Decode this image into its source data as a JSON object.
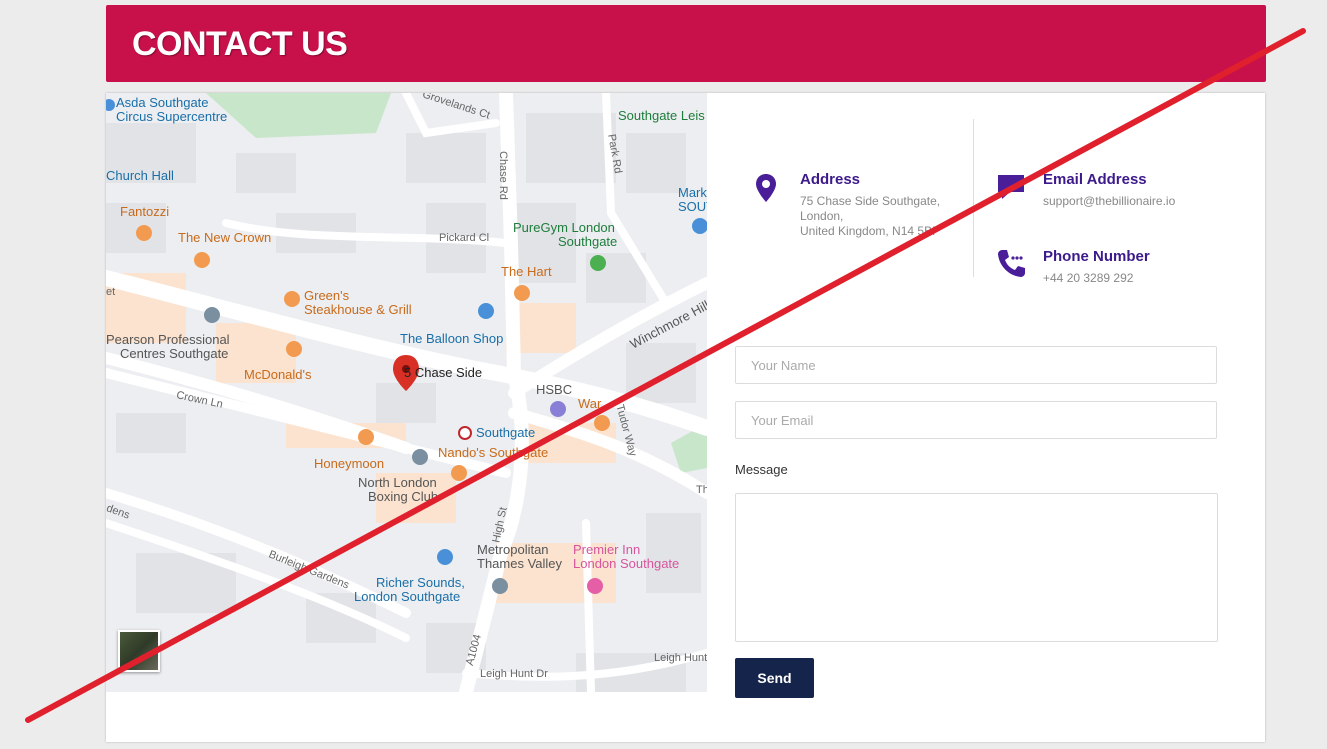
{
  "header": {
    "title": "CONTACT US",
    "color": "#c8104a"
  },
  "map": {
    "pin_label": "5 Chase Side",
    "labels": {
      "asda": "Asda Southgate",
      "asda2": "Circus Supercentre",
      "grovelands": "Grovelands Ct",
      "southgate_leis": "Southgate Leis",
      "park_rd": "Park Rd",
      "church_hall": "Church Hall",
      "chase_rd": "Chase Rd",
      "mark": "Mark",
      "sout": "SOUT",
      "fantozzi": "Fantozzi",
      "new_crown": "The New Crown",
      "pickard": "Pickard Cl",
      "puregym": "PureGym London",
      "puregym2": "Southgate",
      "the_hart": "The Hart",
      "greens": "Green's",
      "greens2": "Steakhouse & Grill",
      "winchmore": "Winchmore Hill",
      "pearson": "Pearson Professional",
      "pearson2": "Centres Southgate",
      "balloon": "The Balloon Shop",
      "mcdonalds": "McDonald's",
      "hsbc": "HSBC",
      "crown_ln": "Crown Ln",
      "war": "War",
      "tudor": "Tudor Way",
      "southgate": "Southgate",
      "nandos": "Nando's Southgate",
      "honeymoon": "Honeymoon",
      "north_london": "North London",
      "boxing": "Boxing Club",
      "high_st": "High St",
      "th": "Th",
      "dens": "dens",
      "metropolitan": "Metropolitan",
      "thames": "Thames Valley",
      "premier": "Premier Inn",
      "premier2": "London Southgate",
      "burleigh": "Burleigh Gardens",
      "richer": "Richer Sounds,",
      "richer2": "London Southgate",
      "a1004": "A1004",
      "leigh_hunt": "Leigh Hunt",
      "leigh_hunt_dr": "Leigh Hunt Dr",
      "et": "et"
    }
  },
  "contact": {
    "address_title": "Address",
    "address_line1": "75 Chase Side Southgate,",
    "address_line2": "London,",
    "address_line3": "United Kingdom, N14 5BP",
    "email_title": "Email Address",
    "email": "support@thebillionaire.io",
    "phone_title": "Phone Number",
    "phone": "+44 20 3289 292"
  },
  "form": {
    "name_placeholder": "Your Name",
    "email_placeholder": "Your Email",
    "message_label": "Message",
    "send_label": "Send"
  },
  "colors": {
    "accent": "#3d1a8c",
    "button": "#15244a",
    "strike": "#e0202c"
  }
}
